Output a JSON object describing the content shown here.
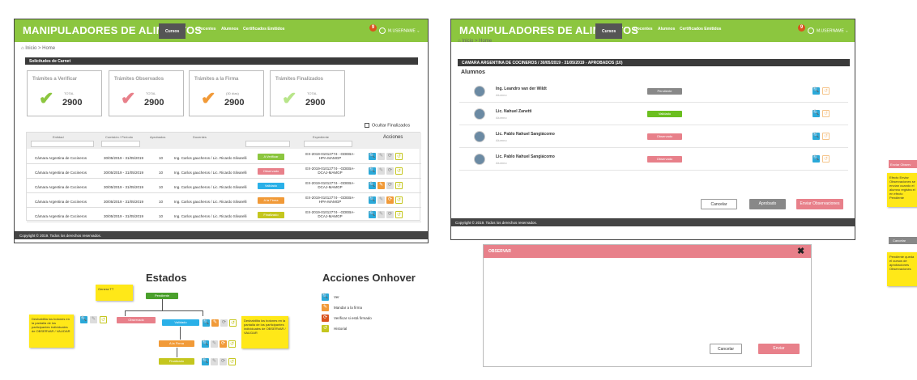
{
  "app": {
    "title": "MANIPULADORES DE ALIMENTOS",
    "nav": [
      "Cursos",
      "Docentes",
      "Alumnos",
      "Certificados Emitidos"
    ],
    "notifications": "9",
    "user": "M.USERNAME"
  },
  "breadcrumb": "Inicio > Home",
  "left": {
    "section": "Solicitudes de Carnet",
    "cards": [
      {
        "title": "Trámites a Verificar",
        "label": "TOTAL",
        "value": "2900",
        "color": "#8cc63f"
      },
      {
        "title": "Trámites Observados",
        "label": "TOTAL",
        "value": "2900",
        "color": "#e8808a"
      },
      {
        "title": "Trámites a la Firma",
        "label": "(30 días)",
        "value": "2900",
        "color": "#f19a38"
      },
      {
        "title": "Trámites Finalizados",
        "label": "TOTAL",
        "value": "2900",
        "color": "#b8e58a"
      }
    ],
    "hide_finalized": "Ocultar Finalizados",
    "columns": [
      "Entidad",
      "Comisión / Período",
      "Aprobados",
      "Docentes",
      "",
      "Expediente",
      "Acciones"
    ],
    "rows": [
      {
        "entity": "Cámara Argentina de Cocineros",
        "period": "30/05/2019 - 31/05/2019",
        "approved": "10",
        "teachers": "Ing. Carlos gaucheros / Lic. Ricardo Silvarelli",
        "status": "A Verificar",
        "status_color": "#8cc63f",
        "file": "EX-2019-01012774- -GDEBA-HPA-MAMGP"
      },
      {
        "entity": "Cámara Argentina de Cocineros",
        "period": "30/05/2019 - 31/05/2019",
        "approved": "10",
        "teachers": "Ing. Carlos gaucheros / Lic. Ricardo Silvarelli",
        "status": "Observado",
        "status_color": "#e8808a",
        "file": "EX-2019-01012774- -GDEBA-DCAJ-MAMGP"
      },
      {
        "entity": "Cámara Argentina de Cocineros",
        "period": "30/05/2019 - 31/05/2019",
        "approved": "10",
        "teachers": "Ing. Carlos gaucheros / Lic. Ricardo Silvarelli",
        "status": "Validado",
        "status_color": "#2ab0e8",
        "file": "EX-2019-01012774- -GDEBA-DCAJ-MAMGP"
      },
      {
        "entity": "Cámara Argentina de Cocineros",
        "period": "30/05/2019 - 31/05/2019",
        "approved": "10",
        "teachers": "Ing. Carlos gaucheros / Lic. Ricardo Silvarelli",
        "status": "A la Firma",
        "status_color": "#f19a38",
        "file": "EX-2019-01012774- -GDEBA-HPA-MAMGP"
      },
      {
        "entity": "Cámara Argentina de Cocineros",
        "period": "30/05/2019 - 31/05/2019",
        "approved": "10",
        "teachers": "Ing. Carlos gaucheros / Lic. Ricardo Silvarelli",
        "status": "Finalizado",
        "status_color": "#c4c61e",
        "file": "EX-2019-01012774- -GDEBA-DCAJ-MAMGP"
      }
    ],
    "footer": "Copyright © 2019. Todos los derechos reservados."
  },
  "estados": {
    "title": "Estados",
    "states": [
      "Pendiente",
      "Observado",
      "Validado",
      "A la Firma",
      "Finalizado"
    ],
    "note_top": "Genera TT",
    "note_left": "Deshabilita los botones en la pantalla de los participantes individuales de OBSERVAR / VALIDAR",
    "note_right": "Deshabilita los botones en la pantalla de los participantes individuales de OBSERVAR / VALIDAR"
  },
  "acciones": {
    "title": "Acciones Onhover",
    "items": [
      "Ver",
      "Mandar a la firma",
      "Verificar si está firmado",
      "Historial"
    ]
  },
  "right": {
    "course_bar": "CAMARA ARGENTINA DE COCINEROS / 30/05/2019 - 31/05/2019 - APROBADOS (10)",
    "students_title": "Alumnos",
    "students": [
      {
        "name": "Ing. Leandro van der Wildt",
        "role": "Alumno",
        "status": "Pendiente",
        "status_color": "#888888"
      },
      {
        "name": "Lic. Nahuel Zanetti",
        "role": "Alumno",
        "status": "Validado",
        "status_color": "#6bbf1f"
      },
      {
        "name": "Lic. Pablo Nahuel Sangiácomo",
        "role": "Alumno",
        "status": "Observado",
        "status_color": "#e8808a"
      },
      {
        "name": "Lic. Pablo Nahuel Sangiácomo",
        "role": "Alumno",
        "status": "Observado",
        "status_color": "#e8808a"
      }
    ],
    "btn_cancel": "Cancelar",
    "btn_approve": "Aprobado",
    "btn_send": "Enviar Observaciones",
    "footer": "Copyright © 2019. Todos los derechos reservados.",
    "modal_title": "OBSERVAR",
    "modal_cancel": "Cancelar",
    "modal_send": "Enviar"
  },
  "edge": {
    "send_obs": "Enviar Observ",
    "note1": "Efecto Enviar Observaciones se envían cuando el alumno registra el en efecto Pendiente",
    "cancel": "Cancelar",
    "note2": "Pendiente queda el cursos de aprobaciones Observaciones"
  }
}
